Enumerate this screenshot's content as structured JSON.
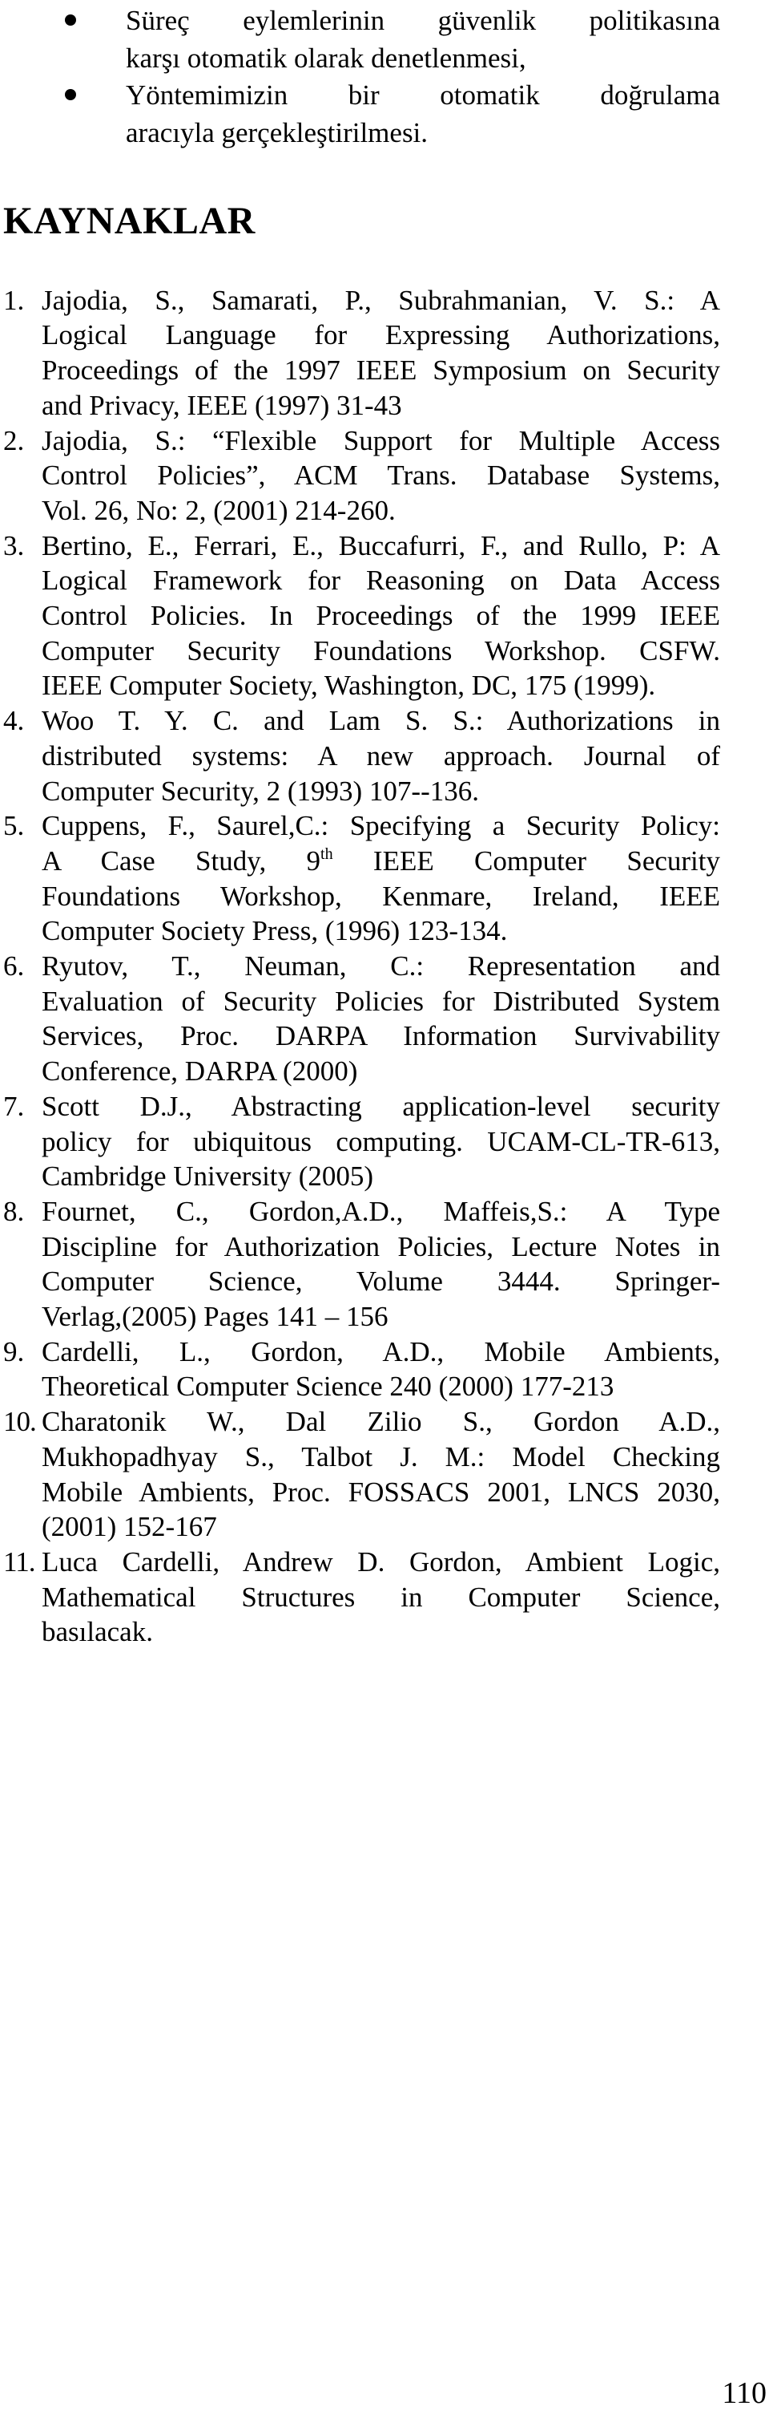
{
  "bullets": [
    {
      "lines": [
        "Süreç eylemlerinin güvenlik politikasına",
        "karşı otomatik olarak denetlenmesi,"
      ]
    },
    {
      "lines": [
        "Yöntemimizin bir otomatik doğrulama",
        "aracıyla gerçekleştirilmesi."
      ]
    }
  ],
  "references_heading": "KAYNAKLAR",
  "references": [
    {
      "number": "1.",
      "lines": [
        "Jajodia, S., Samarati, P., Subrahmanian, V. S.: A",
        "Logical Language for Expressing Authorizations,",
        "Proceedings of the 1997 IEEE Symposium on Security",
        "and Privacy, IEEE (1997) 31-43"
      ]
    },
    {
      "number": "2.",
      "lines": [
        "Jajodia, S.: “Flexible Support for Multiple Access",
        "Control Policies”, ACM Trans. Database Systems,",
        "Vol. 26, No: 2, (2001) 214-260."
      ]
    },
    {
      "number": "3.",
      "lines": [
        "Bertino, E., Ferrari, E., Buccafurri, F., and Rullo, P: A",
        "Logical Framework for Reasoning on Data Access",
        "Control Policies. In Proceedings of the 1999 IEEE",
        "Computer Security Foundations Workshop. CSFW.",
        "IEEE Computer Society, Washington, DC, 175 (1999)."
      ]
    },
    {
      "number": "4.",
      "lines": [
        "Woo T. Y. C. and Lam S. S.: Authorizations in",
        "distributed systems: A new approach. Journal of",
        "Computer Security, 2 (1993) 107--136."
      ]
    },
    {
      "number": "5.",
      "lines": [
        "Cuppens, F., Saurel,C.: Specifying a Security Policy:",
        "A Case Study, 9^th IEEE Computer Security",
        "Foundations Workshop, Kenmare, Ireland, IEEE",
        "Computer Society Press,  (1996) 123-134."
      ]
    },
    {
      "number": "6.",
      "lines": [
        "Ryutov, T., Neuman, C.: Representation and",
        "Evaluation of Security Policies for Distributed System",
        "Services, Proc. DARPA Information Survivability",
        "Conference, DARPA (2000)"
      ]
    },
    {
      "number": "7.",
      "lines": [
        "Scott D.J., Abstracting application-level security",
        "policy for ubiquitous computing. UCAM-CL-TR-613,",
        "Cambridge University (2005)"
      ]
    },
    {
      "number": "8.",
      "lines": [
        "Fournet, C., Gordon,A.D., Maffeis,S.: A Type",
        "Discipline for Authorization Policies, Lecture Notes in",
        "Computer Science, Volume 3444. Springer-",
        "Verlag,(2005) Pages 141 – 156"
      ]
    },
    {
      "number": "9.",
      "lines": [
        "Cardelli, L., Gordon, A.D., Mobile Ambients,",
        "Theoretical Computer Science 240 (2000) 177-213"
      ]
    },
    {
      "number": "10.",
      "lines": [
        "Charatonik W., Dal Zilio S., Gordon A.D.,",
        "Mukhopadhyay S., Talbot J. M.: Model Checking",
        "Mobile Ambients, Proc. FOSSACS 2001, LNCS 2030,",
        "(2001) 152-167"
      ]
    },
    {
      "number": "11.",
      "lines": [
        "Luca Cardelli, Andrew D. Gordon, Ambient Logic,",
        "Mathematical Structures in Computer Science,",
        "basılacak."
      ]
    }
  ],
  "page_number": "110"
}
